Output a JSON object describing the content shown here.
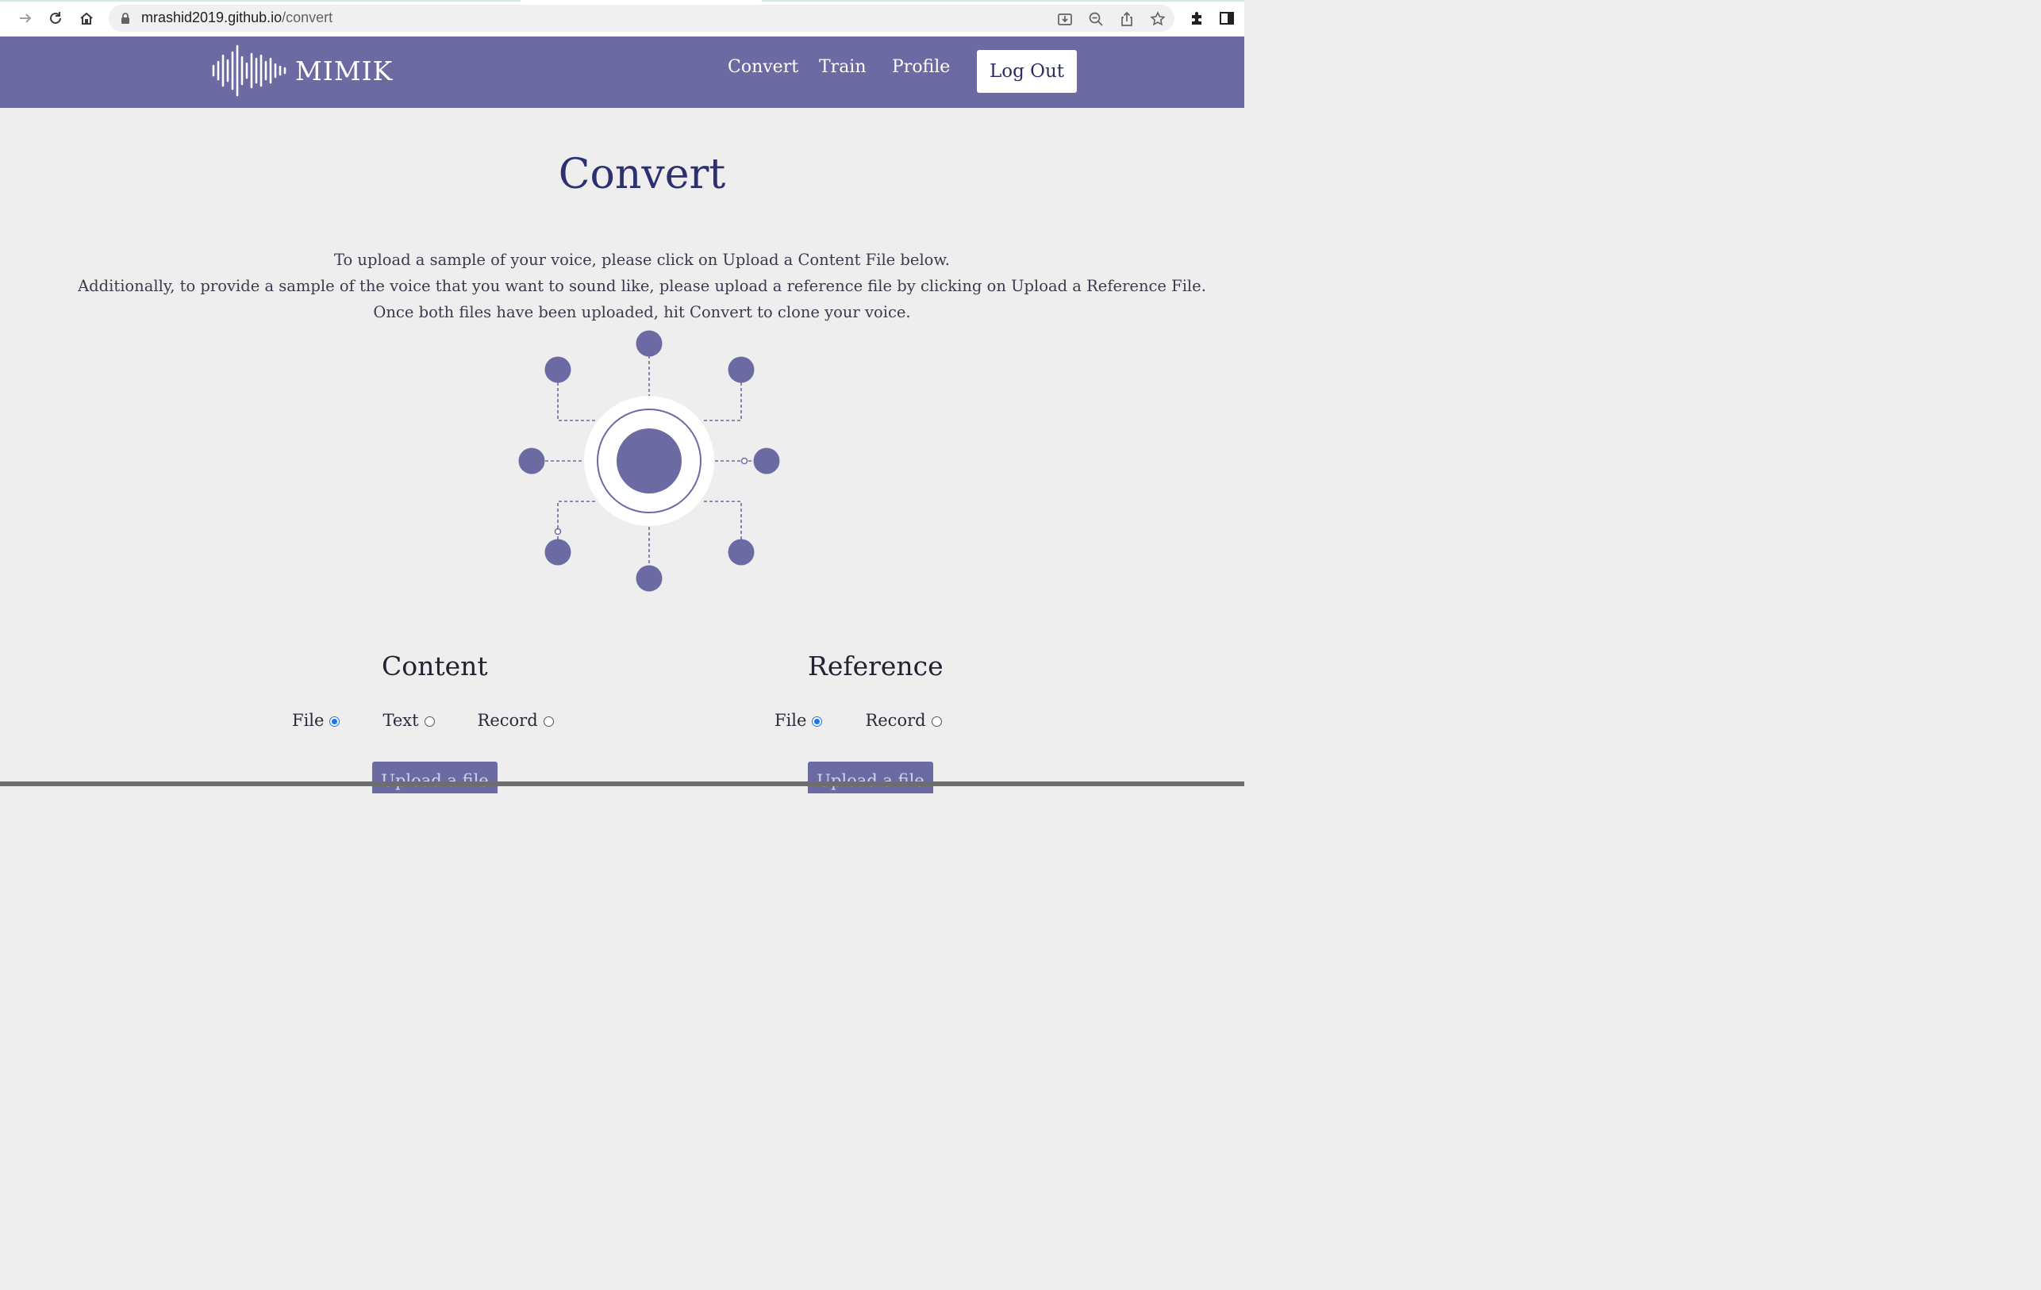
{
  "browser": {
    "url_host": "mrashid2019.github.io",
    "url_path": "/convert"
  },
  "header": {
    "brand": "MIMIK",
    "nav": [
      "Convert",
      "Train",
      "Profile"
    ],
    "logout_label": "Log Out"
  },
  "main": {
    "title": "Convert",
    "intro": [
      "To upload a sample of your voice, please click on Upload a Content File below.",
      "Additionally, to provide a sample of the voice that you want to sound like, please upload a reference file by clicking on Upload a Reference File.",
      "Once both files have been uploaded, hit Convert to clone your voice."
    ]
  },
  "content": {
    "title": "Content",
    "options": [
      "File",
      "Text",
      "Record"
    ],
    "selected": "File",
    "upload_label": "Upload a file"
  },
  "reference": {
    "title": "Reference",
    "options": [
      "File",
      "Record"
    ],
    "selected": "File",
    "upload_label": "Upload a file"
  },
  "colors": {
    "brand": "#6b6aa2",
    "title": "#2b3071",
    "radio": "#1a73e8"
  },
  "icons": [
    "back-arrow-icon",
    "reload-icon",
    "home-icon",
    "lock-icon",
    "install-icon",
    "zoom-out-icon",
    "share-icon",
    "bookmark-star-icon",
    "extensions-icon",
    "sidepanel-icon"
  ]
}
